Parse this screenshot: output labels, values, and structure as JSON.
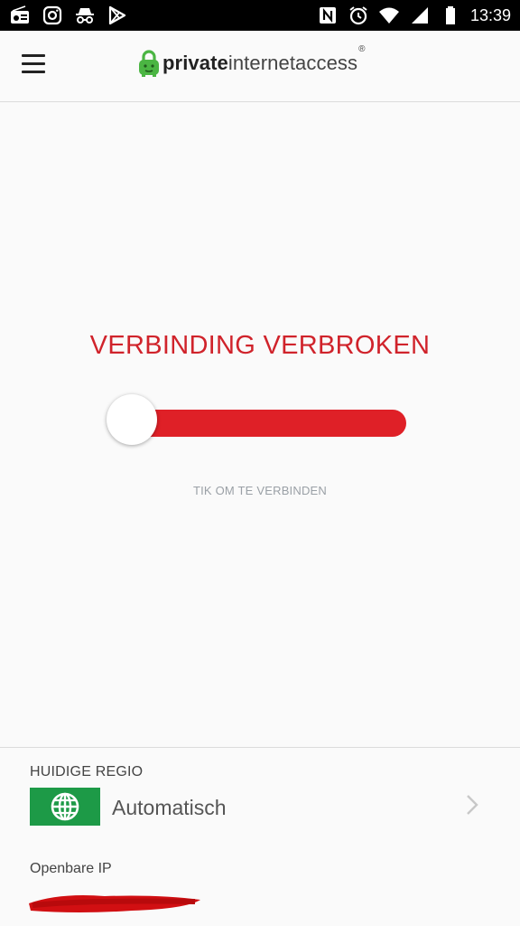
{
  "status_bar": {
    "time": "13:39",
    "left_icons": [
      "radio-icon",
      "instagram-icon",
      "incognito-icon",
      "play-store-icon"
    ],
    "right_icons": [
      "nfc-icon",
      "alarm-icon",
      "wifi-icon",
      "signal-icon",
      "battery-icon"
    ]
  },
  "app_bar": {
    "logo_bold": "private",
    "logo_light": "internetaccess",
    "logo_reg": "®"
  },
  "connection": {
    "status_text": "VERBINDING VERBROKEN",
    "hint": "TIK OM TE VERBINDEN",
    "connected": false,
    "status_color": "#d0232b",
    "toggle_color": "#df2027"
  },
  "region": {
    "label": "HUIDIGE REGIO",
    "value": "Automatisch",
    "flag_color": "#1d9a47",
    "icon": "globe-icon"
  },
  "ip": {
    "label": "Openbare IP"
  }
}
